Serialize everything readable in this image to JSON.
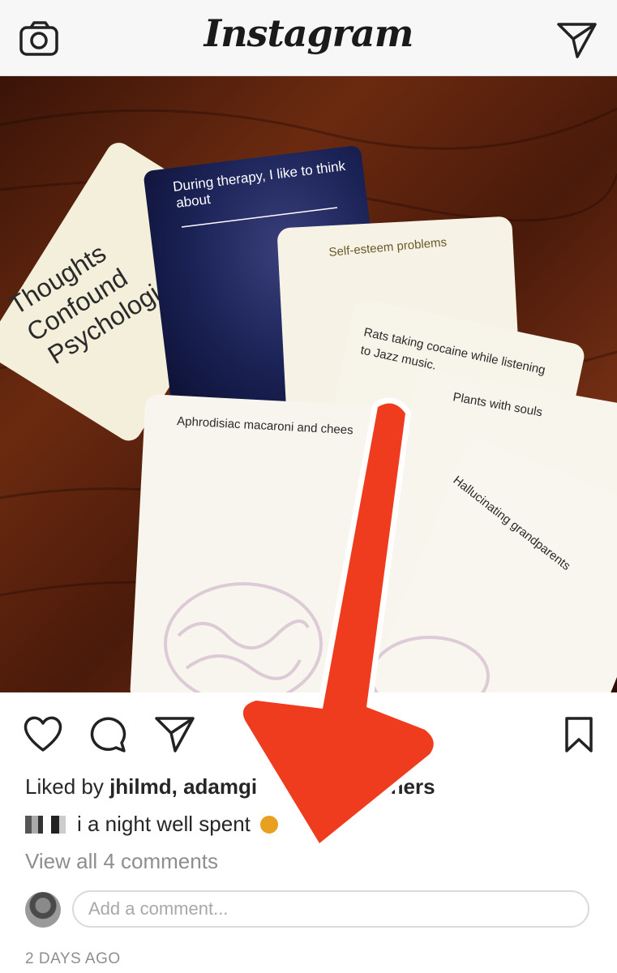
{
  "header": {
    "title": "Instagram",
    "left_icon": "camera-icon",
    "right_icon": "send-icon"
  },
  "post": {
    "cards": {
      "title_card": [
        "Thoughts",
        "Confound",
        "Psychologi"
      ],
      "dark_card_line1": "During therapy, I like to think",
      "dark_card_line2": "about",
      "card_self_esteem": "Self-esteem problems",
      "card_rats_line1": "Rats taking cocaine while listening",
      "card_rats_line2": "to Jazz music.",
      "card_plants": "Plants with souls",
      "card_aphro": "Aphrodisiac macaroni and chees",
      "card_halluc": "Hallucinating grandparents"
    },
    "actions": {
      "like_icon": "heart-icon",
      "comment_icon": "comment-icon",
      "share_icon": "send-icon",
      "save_icon": "bookmark-icon"
    },
    "likes": {
      "prefix": "Liked by ",
      "user1": "jhilmd",
      "sep": ", ",
      "user2": "adamgi",
      "suffix": "others"
    },
    "caption": {
      "text": "i a night well spent"
    },
    "view_all_comments": "View all 4 comments",
    "comment_placeholder": "Add a comment...",
    "timestamp": "2 DAYS AGO"
  },
  "colors": {
    "arrow": "#f03c1e",
    "header_bg": "#f7f7f7",
    "muted_text": "#8e8e8e",
    "dark_card": "#1a2255"
  }
}
